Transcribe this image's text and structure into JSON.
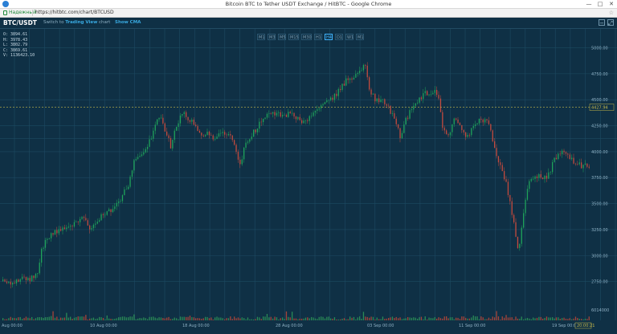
{
  "window": {
    "title": "Bitcoin BTC to Tether USDT Exchange / HitBTC - Google Chrome",
    "min_glyph": "—",
    "max_glyph": "□",
    "close_glyph": "✕"
  },
  "address_bar": {
    "secure_label": "Надежный",
    "url": "https://hitbtc.com/chart/BTCUSD",
    "star_glyph": "☆"
  },
  "chart_header": {
    "pair": "BTC/USDT",
    "switch_prefix": "Switch to",
    "switch_link": "Trading View",
    "switch_suffix": "chart",
    "show_cma": "Show CMA",
    "minus_glyph": "−",
    "expand_glyph": "⤢"
  },
  "ohlc": {
    "open": "O:  3894.61",
    "high": "H:  3978.43",
    "low": "L:  3802.79",
    "close": "C:  3869.61",
    "volume": "V:  1136423.10"
  },
  "timeframes": [
    "M1",
    "M3",
    "M5",
    "M15",
    "M30",
    "H1",
    "H4",
    "D1",
    "W1",
    "M1"
  ],
  "active_timeframe_index": 6,
  "colors": {
    "up": "#1fa35a",
    "down": "#c44a3e",
    "grid": "#1d4a62",
    "background": "#0f3045",
    "price_line": "#c8b94a"
  },
  "chart_data": {
    "type": "candlestick",
    "x_ticks": [
      "Aug 00:00",
      "10 Aug 00:00",
      "18 Aug 00:00",
      "28 Aug 00:00",
      "03 Sep 00:00",
      "11 Sep 00:00",
      "19 Sep 00:00"
    ],
    "y_ticks": [
      "5000.00",
      "4750.00",
      "4500.00",
      "4250.00",
      "4000.00",
      "3750.00",
      "3500.00",
      "3250.00",
      "3000.00",
      "2750.00"
    ],
    "ylim": [
      2600,
      5120
    ],
    "current_price_label": "4427.94",
    "current_price": 4427.94,
    "last_time_label": "20:00:21",
    "volume_label": "6014000",
    "path": [
      [
        0,
        2760
      ],
      [
        14,
        2730
      ],
      [
        25,
        2790
      ],
      [
        36,
        2770
      ],
      [
        46,
        2840
      ],
      [
        52,
        3080
      ],
      [
        62,
        3200
      ],
      [
        73,
        3240
      ],
      [
        85,
        3280
      ],
      [
        95,
        3340
      ],
      [
        105,
        3360
      ],
      [
        113,
        3250
      ],
      [
        122,
        3350
      ],
      [
        132,
        3420
      ],
      [
        140,
        3450
      ],
      [
        148,
        3520
      ],
      [
        155,
        3640
      ],
      [
        160,
        3700
      ],
      [
        166,
        3900
      ],
      [
        172,
        3950
      ],
      [
        180,
        4000
      ],
      [
        187,
        4120
      ],
      [
        193,
        4280
      ],
      [
        198,
        4350
      ],
      [
        205,
        4200
      ],
      [
        212,
        4050
      ],
      [
        219,
        4250
      ],
      [
        227,
        4400
      ],
      [
        235,
        4310
      ],
      [
        243,
        4250
      ],
      [
        251,
        4130
      ],
      [
        259,
        4180
      ],
      [
        267,
        4120
      ],
      [
        275,
        4200
      ],
      [
        284,
        4170
      ],
      [
        292,
        4060
      ],
      [
        298,
        3860
      ],
      [
        303,
        4030
      ],
      [
        311,
        4150
      ],
      [
        319,
        4230
      ],
      [
        327,
        4320
      ],
      [
        335,
        4370
      ],
      [
        343,
        4360
      ],
      [
        351,
        4340
      ],
      [
        359,
        4370
      ],
      [
        367,
        4340
      ],
      [
        375,
        4300
      ],
      [
        383,
        4320
      ],
      [
        391,
        4380
      ],
      [
        399,
        4440
      ],
      [
        407,
        4500
      ],
      [
        415,
        4530
      ],
      [
        423,
        4600
      ],
      [
        431,
        4700
      ],
      [
        439,
        4720
      ],
      [
        447,
        4780
      ],
      [
        454,
        4850
      ],
      [
        459,
        4610
      ],
      [
        467,
        4480
      ],
      [
        475,
        4510
      ],
      [
        483,
        4420
      ],
      [
        491,
        4300
      ],
      [
        498,
        4130
      ],
      [
        504,
        4300
      ],
      [
        512,
        4420
      ],
      [
        520,
        4510
      ],
      [
        528,
        4560
      ],
      [
        536,
        4580
      ],
      [
        544,
        4560
      ],
      [
        550,
        4260
      ],
      [
        557,
        4150
      ],
      [
        565,
        4330
      ],
      [
        573,
        4210
      ],
      [
        581,
        4130
      ],
      [
        589,
        4260
      ],
      [
        597,
        4300
      ],
      [
        605,
        4300
      ],
      [
        611,
        4170
      ],
      [
        617,
        3990
      ],
      [
        624,
        3820
      ],
      [
        629,
        3700
      ],
      [
        634,
        3520
      ],
      [
        640,
        3250
      ],
      [
        645,
        3010
      ],
      [
        650,
        3350
      ],
      [
        657,
        3700
      ],
      [
        665,
        3760
      ],
      [
        672,
        3780
      ],
      [
        680,
        3730
      ],
      [
        688,
        3900
      ],
      [
        696,
        4000
      ],
      [
        703,
        3980
      ],
      [
        710,
        3930
      ],
      [
        718,
        3880
      ],
      [
        726,
        3860
      ],
      [
        733,
        3870
      ]
    ]
  }
}
